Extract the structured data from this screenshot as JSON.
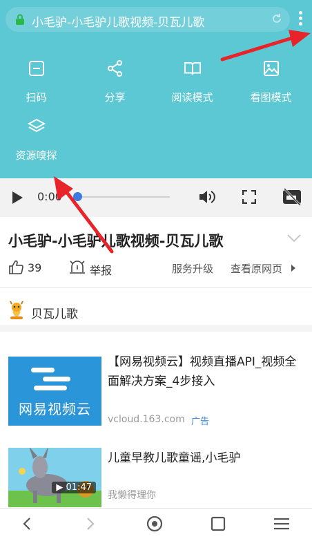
{
  "browser": {
    "url_text": "小毛驴-小毛驴儿歌视频-贝瓦儿歌"
  },
  "menu": {
    "items": [
      {
        "label": "扫码",
        "icon": "scan-icon"
      },
      {
        "label": "分享",
        "icon": "share-icon"
      },
      {
        "label": "阅读模式",
        "icon": "book-icon"
      },
      {
        "label": "看图模式",
        "icon": "image-icon"
      },
      {
        "label": "资源嗅探",
        "icon": "layers-icon"
      }
    ]
  },
  "player": {
    "current_time": "0:00",
    "progress": 0.0
  },
  "video": {
    "title": "小毛驴-小毛驴儿歌视频-贝瓦儿歌",
    "likes": "39",
    "report_label": "举报",
    "upgrade_label": "服务升级",
    "original_label": "查看原网页"
  },
  "channel": {
    "name": "贝瓦儿歌"
  },
  "feed": {
    "ad": {
      "title": "【网易视频云】视频直播API_视频全面解决方案_4步接入",
      "domain": "vcloud.163.com",
      "tag": "广告",
      "thumb_text": "网易视频云"
    },
    "recommendation": {
      "title": "儿童早教儿歌童谣,小毛驴",
      "author": "我懒得理你",
      "duration": "01:47"
    }
  },
  "colors": {
    "menu_bg": "#5cc8d3",
    "arrow": "#e8242a",
    "progress_knob": "#3d7be0",
    "ad_tag": "#3d8ce0"
  }
}
